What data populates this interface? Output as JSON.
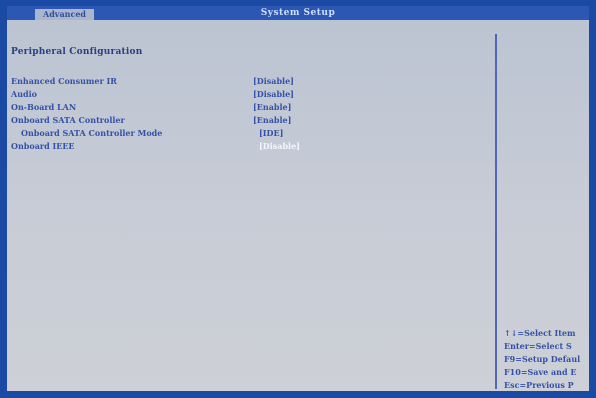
{
  "header": {
    "title": "System Setup",
    "active_tab": "Advanced"
  },
  "page": {
    "title": "Peripheral Configuration"
  },
  "settings": [
    {
      "label": "Enhanced Consumer IR",
      "value": "[Disable]"
    },
    {
      "label": "Audio",
      "value": "[Disable]"
    },
    {
      "label": "On-Board LAN",
      "value": "[Enable]"
    },
    {
      "label": "Onboard SATA Controller",
      "value": "[Enable]"
    },
    {
      "label": "Onboard SATA Controller Mode",
      "value": "[IDE]"
    },
    {
      "label": "Onboard IEEE",
      "value": "[Disable]",
      "selected": true
    }
  ],
  "help": {
    "lines": [
      "↑↓=Select Item",
      "Enter=Select S",
      "F9=Setup Defaul",
      "F10=Save and E",
      "Esc=Previous P"
    ]
  },
  "colors": {
    "frame": "#1a4aa3",
    "header_bar": "#2d57b4",
    "background": "#bcc3cf",
    "text": "#3451a8",
    "selected_text": "#f4f7ff"
  }
}
